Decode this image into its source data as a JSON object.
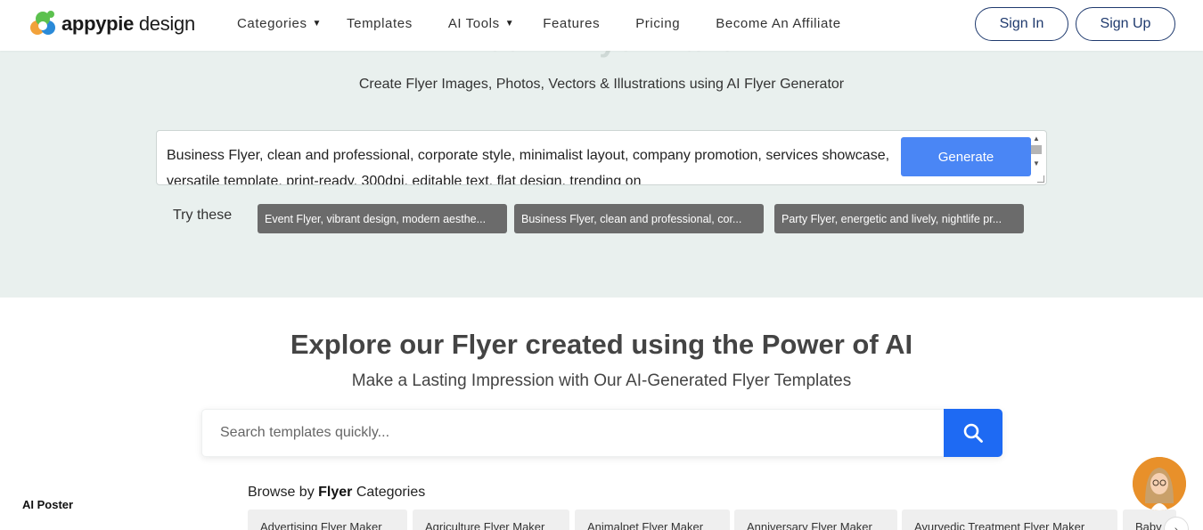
{
  "header": {
    "logo_brand": "appypie",
    "logo_product": "design",
    "nav": [
      {
        "label": "Categories",
        "has_caret": true
      },
      {
        "label": "Templates",
        "has_caret": false
      },
      {
        "label": "AI Tools",
        "has_caret": true
      },
      {
        "label": "Features",
        "has_caret": false
      },
      {
        "label": "Pricing",
        "has_caret": false
      },
      {
        "label": "Become An Affiliate",
        "has_caret": false
      }
    ],
    "sign_in": "Sign In",
    "sign_up": "Sign Up"
  },
  "hero": {
    "faded_title": "Free AI Flyer Maker",
    "subtitle": "Create Flyer Images, Photos, Vectors & Illustrations using AI Flyer Generator",
    "prompt_text": "Business Flyer, clean and professional, corporate style, minimalist layout, company promotion, services showcase, versatile template, print-ready, 300dpi, editable text, flat design, trending on",
    "generate_label": "Generate",
    "try_label": "Try these",
    "suggestions": [
      "Event Flyer, vibrant design, modern aesthe...",
      "Business Flyer, clean and professional, cor...",
      "Party Flyer, energetic and lively, nightlife pr..."
    ]
  },
  "explore": {
    "title": "Explore our Flyer created using the Power of AI",
    "subtitle": "Make a Lasting Impression with Our AI-Generated Flyer Templates",
    "search_placeholder": "Search templates quickly..."
  },
  "sidebar": {
    "label": "AI Poster"
  },
  "browse": {
    "prefix": "Browse by ",
    "bold": "Flyer",
    "suffix": " Categories",
    "categories": [
      "Advertising Flyer Maker",
      "Agriculture Flyer Maker",
      "Animalpet Flyer Maker",
      "Anniversary Flyer Maker",
      "Ayurvedic Treatment Flyer Maker",
      "Baby"
    ]
  },
  "colors": {
    "accent_blue": "#1e6af3",
    "generate_blue": "#4a86f5",
    "hero_bg": "#e9f0ee",
    "outline_navy": "#1f3a6e",
    "chip_gray": "#6b6b6b"
  },
  "icons": {
    "logo": "appypie-logo-icon",
    "search": "search-icon",
    "caret": "caret-down-icon",
    "next": "chevron-right-icon",
    "avatar": "assistant-avatar-icon"
  }
}
